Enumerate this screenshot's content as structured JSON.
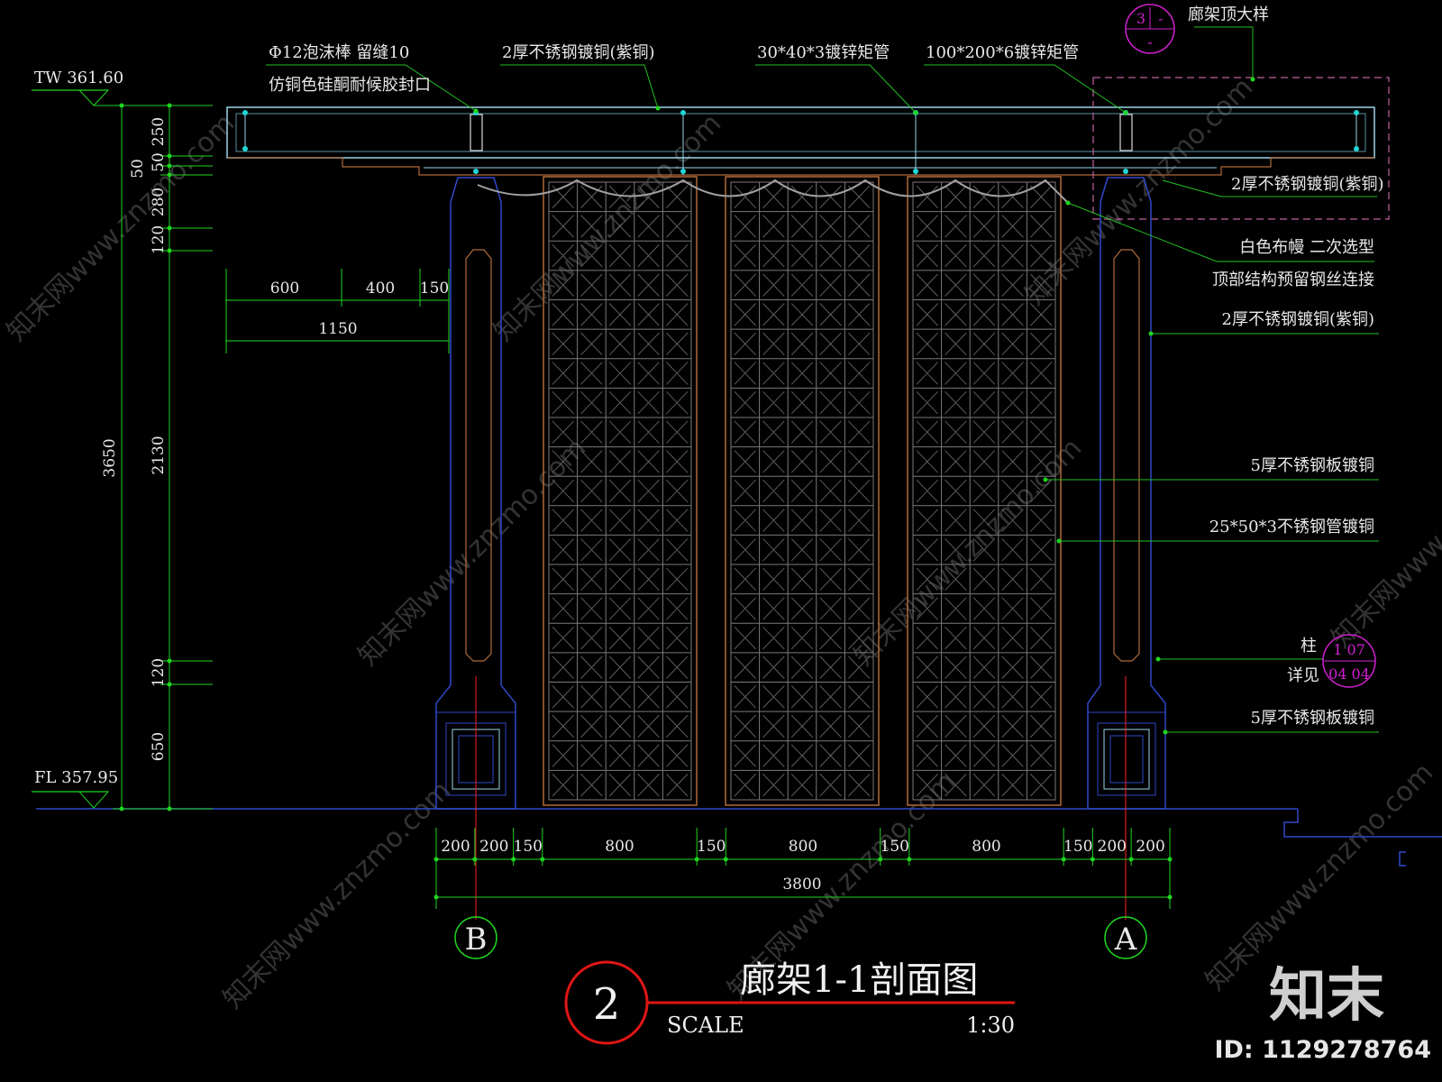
{
  "colors": {
    "background": "#000000",
    "dimension_line": "#1fd61f",
    "leader_line": "#22c022",
    "text": "#e8e8e8",
    "frame_brown": "#b06a3a",
    "column_blue": "#2f48c8",
    "beam_cyan": "#9ad6e8",
    "callout_magenta": "#d020d0",
    "axis_red": "#ff2020",
    "title_red": "#e01515",
    "watermark": "#333333"
  },
  "title": {
    "number": "2",
    "text": "廊架1-1剖面图",
    "scale_label": "SCALE",
    "scale_value": "1:30"
  },
  "axes": {
    "left": "B",
    "right": "A"
  },
  "levels": {
    "top": "TW 361.60",
    "bottom": "FL 357.95"
  },
  "callouts": {
    "roof_detail": {
      "top": "3",
      "right": "-",
      "bottom": "-",
      "label": "廊架顶大样"
    },
    "column_detail": {
      "top": "1 07",
      "bottom": "04 04",
      "label_1": "柱",
      "label_2": "详见"
    }
  },
  "annotations": {
    "foam_rod": "Φ12泡沫棒  留缝10",
    "sealant": "仿铜色硅酮耐候胶封口",
    "top_plate": "2厚不锈钢镀铜(紫铜)",
    "tube_small": "30*40*3镀锌矩管",
    "tube_large": "100*200*6镀锌矩管",
    "right_plate": "2厚不锈钢镀铜(紫铜)",
    "curtain": "白色布幔  二次选型",
    "wire_connect": "顶部结构预留钢丝连接",
    "column_plate": "2厚不锈钢镀铜(紫铜)",
    "screen_plate": "5厚不锈钢板镀铜",
    "screen_tube": "25*50*3不锈钢管镀铜",
    "base_plate": "5厚不锈钢板镀铜"
  },
  "vertical_dimensions": {
    "outer": [
      "3650"
    ],
    "inner": [
      "250",
      "50",
      "50",
      "280",
      "120",
      "2130",
      "120",
      "650"
    ]
  },
  "horizontal_dimensions": {
    "upper": [
      "600",
      "400",
      "150"
    ],
    "upper_total": "1150",
    "bottom": [
      "200",
      "200",
      "150",
      "800",
      "150",
      "800",
      "150",
      "800",
      "150",
      "200",
      "200"
    ],
    "bottom_total": "3800"
  },
  "watermark": {
    "site": "知末网www.znzmo.com",
    "site_short": "znzmo.com",
    "brand": "知末",
    "image_id": "ID: 1129278764"
  }
}
